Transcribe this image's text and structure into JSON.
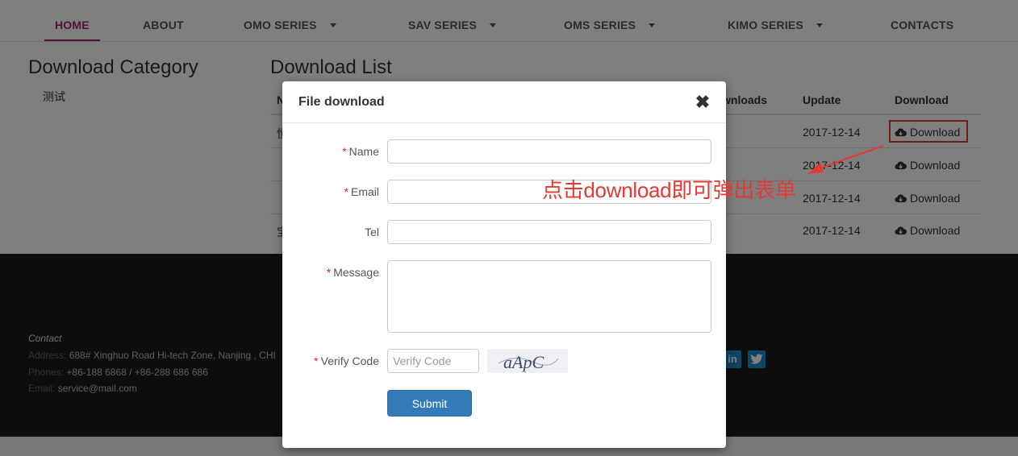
{
  "nav": {
    "items": [
      {
        "label": "HOME",
        "active": true
      },
      {
        "label": "ABOUT"
      },
      {
        "label": "OMO SERIES",
        "dropdown": true
      },
      {
        "label": "SAV SERIES",
        "dropdown": true
      },
      {
        "label": "OMS SERIES",
        "dropdown": true
      },
      {
        "label": "KIMO SERIES",
        "dropdown": true
      },
      {
        "label": "CONTACTS"
      }
    ],
    "active_color": "#a0246e"
  },
  "category": {
    "title": "Download Category",
    "items": [
      "测试"
    ]
  },
  "list": {
    "title": "Download List",
    "headers": {
      "name": "N",
      "downloads": "wnloads",
      "update": "Update",
      "download": "Download"
    },
    "rows": [
      {
        "name": "恒",
        "update": "2017-12-14",
        "action": "Download"
      },
      {
        "name": "",
        "update": "2017-12-14",
        "action": "Download"
      },
      {
        "name": "",
        "update": "2017-12-14",
        "action": "Download"
      },
      {
        "name": "宝",
        "update": "2017-12-14",
        "action": "Download"
      }
    ]
  },
  "footer": {
    "contact_heading": "Contact",
    "address_label": "Address:",
    "address_value": "688# Xinghuo Road Hi-tech Zone, Nanjing , CHI",
    "phones_label": "Phones:",
    "phones_value": "+86-188 6868 / +86-288 686 686",
    "email_label": "Email:",
    "email_value": "service@mail.com",
    "social": [
      "in",
      "twitter-icon"
    ]
  },
  "modal": {
    "title": "File download",
    "close_symbol": "✖",
    "fields": {
      "name": {
        "label": "Name",
        "required": "*"
      },
      "email": {
        "label": "Email",
        "required": "*"
      },
      "tel": {
        "label": "Tel"
      },
      "message": {
        "label": "Message",
        "required": "*"
      },
      "verify": {
        "label": "Verify Code",
        "required": "*",
        "placeholder": "Verify Code"
      }
    },
    "captcha_text": "aApC",
    "submit_label": "Submit",
    "submit_color": "#337ab7"
  },
  "annotation": {
    "text": "点击download即可弹出表单",
    "color": "#e53935"
  }
}
